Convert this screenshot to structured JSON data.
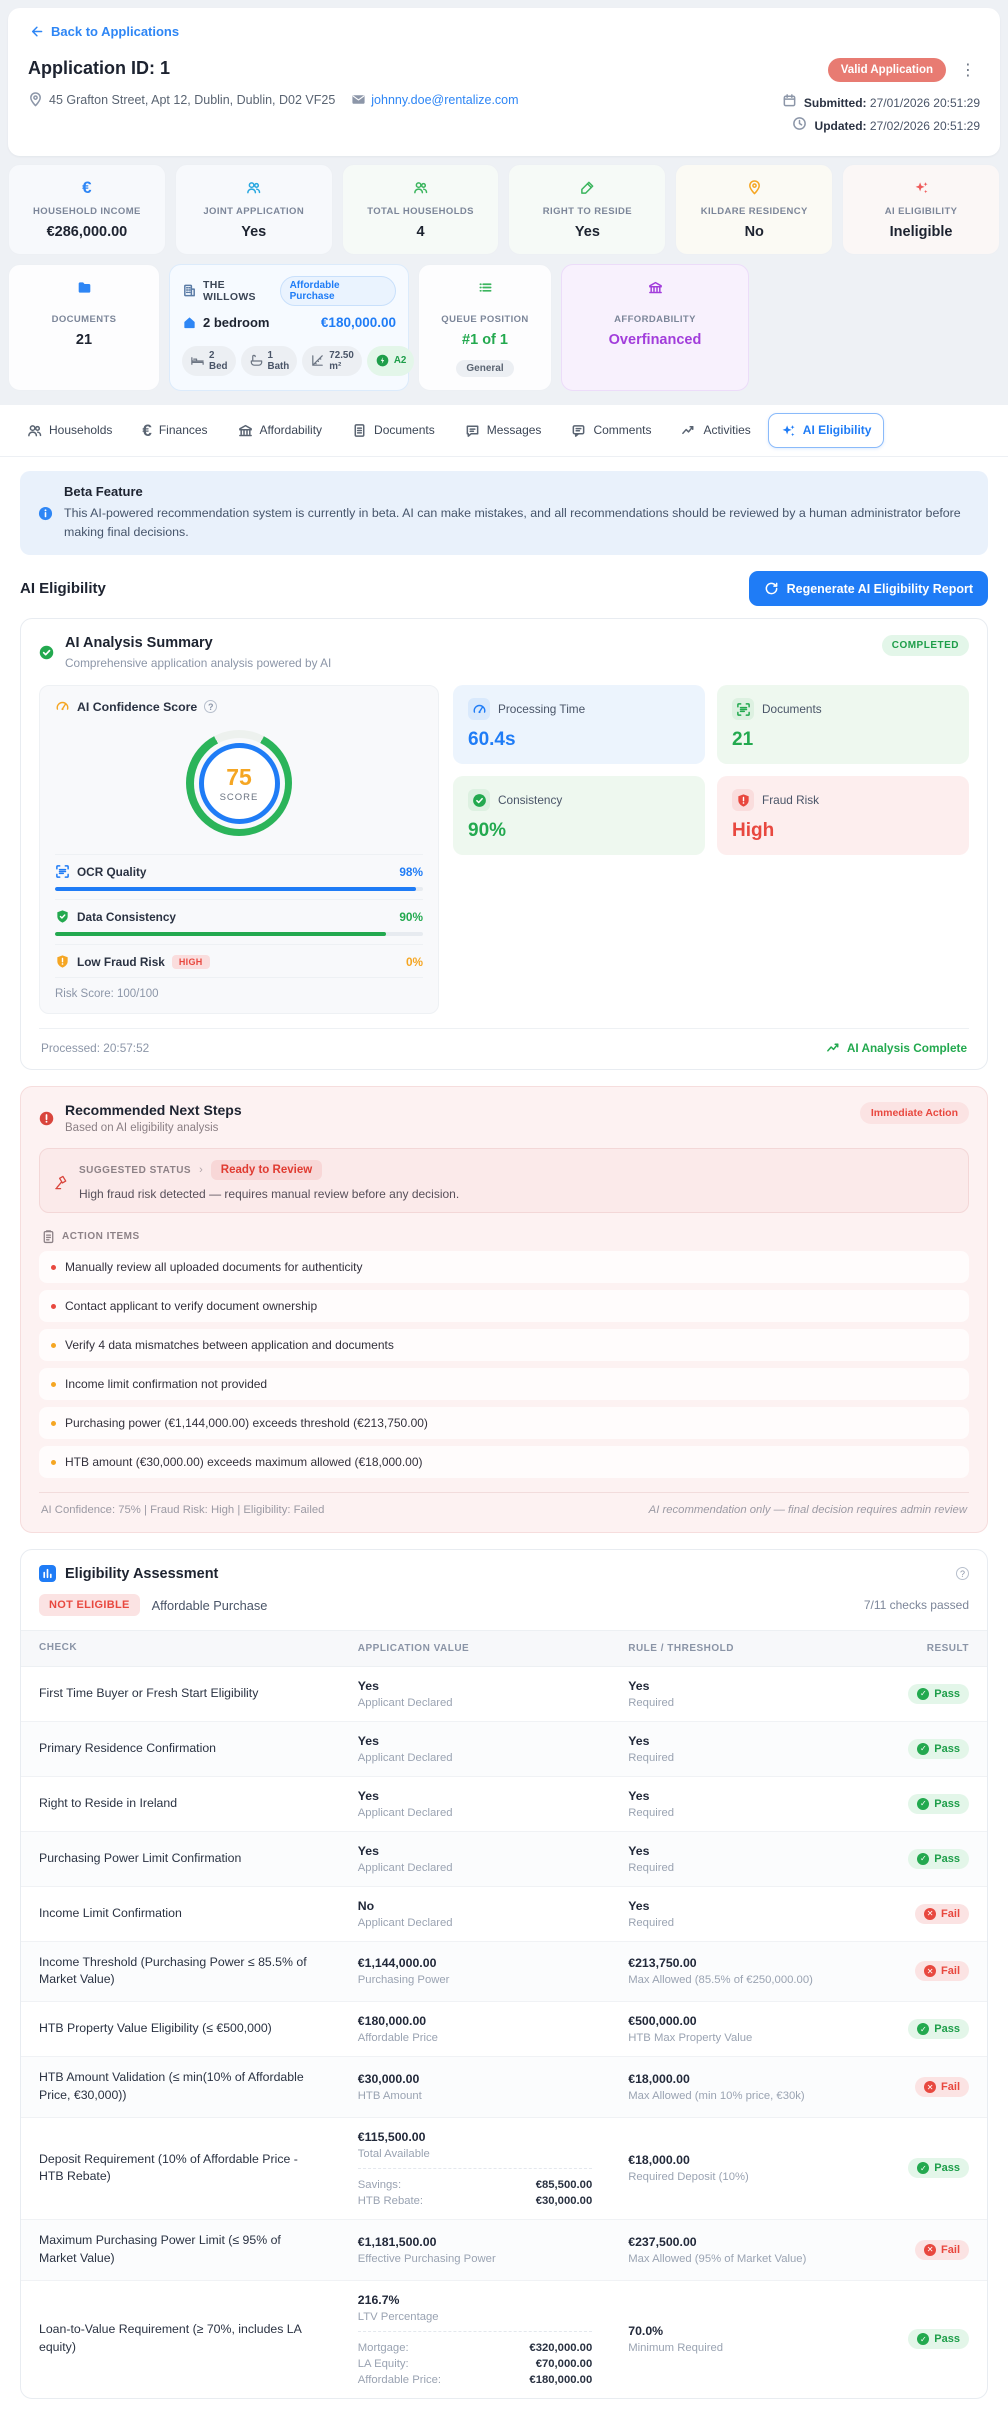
{
  "colors": {
    "accent_blue": "#1f7cf6",
    "green": "#23a94f",
    "red": "#e8483f",
    "orange": "#f5a623",
    "purple": "#a23ddb"
  },
  "header": {
    "back_label": "Back to Applications",
    "title": "Application ID: 1",
    "address": "45 Grafton Street, Apt 12, Dublin, Dublin, D02 VF25",
    "email": "johnny.doe@rentalize.com",
    "status_badge": "Valid Application",
    "submitted_label": "Submitted:",
    "submitted_value": "27/01/2026 20:51:29",
    "updated_label": "Updated:",
    "updated_value": "27/02/2026 20:51:29"
  },
  "stats": [
    {
      "label": "HOUSEHOLD INCOME",
      "value": "€286,000.00",
      "icon": "euro-icon",
      "accent": "#2e86f5"
    },
    {
      "label": "JOINT APPLICATION",
      "value": "Yes",
      "icon": "users-icon",
      "accent": "#29a8e0"
    },
    {
      "label": "TOTAL HOUSEHOLDS",
      "value": "4",
      "icon": "users-icon",
      "accent": "#3bb55e"
    },
    {
      "label": "RIGHT TO RESIDE",
      "value": "Yes",
      "icon": "signature-icon",
      "accent": "#3bb55e"
    },
    {
      "label": "KILDARE RESIDENCY",
      "value": "No",
      "icon": "location-pin-icon",
      "accent": "#f5a623"
    },
    {
      "label": "AI ELIGIBILITY",
      "value": "Ineligible",
      "icon": "sparkles-icon",
      "accent": "#ef5b5b"
    }
  ],
  "documents_card": {
    "label": "DOCUMENTS",
    "value": "21"
  },
  "property": {
    "name": "THE WILLOWS",
    "tag": "Affordable Purchase",
    "type": "2 bedroom",
    "price": "€180,000.00",
    "chips": [
      {
        "label": "2 Bed",
        "icon": "bed-icon"
      },
      {
        "label": "1 Bath",
        "icon": "bath-icon"
      },
      {
        "label": "72.50 m²",
        "icon": "ruler-icon"
      }
    ],
    "energy_rating": "A2"
  },
  "queue_card": {
    "label": "QUEUE POSITION",
    "value": "#1 of 1",
    "chip": "General"
  },
  "affordability_card": {
    "label": "AFFORDABILITY",
    "value": "Overfinanced"
  },
  "tabs": [
    {
      "label": "Households",
      "icon": "users-icon",
      "active": false
    },
    {
      "label": "Finances",
      "icon": "euro-icon",
      "active": false
    },
    {
      "label": "Affordability",
      "icon": "bank-icon",
      "active": false
    },
    {
      "label": "Documents",
      "icon": "document-icon",
      "active": false
    },
    {
      "label": "Messages",
      "icon": "message-icon",
      "active": false
    },
    {
      "label": "Comments",
      "icon": "comment-icon",
      "active": false
    },
    {
      "label": "Activities",
      "icon": "activity-icon",
      "active": false
    },
    {
      "label": "AI Eligibility",
      "icon": "sparkles-icon",
      "active": true
    }
  ],
  "beta": {
    "title": "Beta Feature",
    "text": "This AI-powered recommendation system is currently in beta. AI can make mistakes, and all recommendations should be reviewed by a human administrator before making final decisions."
  },
  "section": {
    "title": "AI Eligibility",
    "button": "Regenerate AI Eligibility Report"
  },
  "summary": {
    "title": "AI Analysis Summary",
    "subtitle": "Comprehensive application analysis powered by AI",
    "status": "COMPLETED",
    "confidence_label": "AI Confidence Score",
    "score": "75",
    "score_caption": "SCORE",
    "bars": [
      {
        "label": "OCR Quality",
        "icon": "scan-icon",
        "value": "98%",
        "pct": 98,
        "color": "#1f7cf6",
        "badge": "",
        "has_bar": true
      },
      {
        "label": "Data Consistency",
        "icon": "shield-check-icon",
        "value": "90%",
        "pct": 90,
        "color": "#23a94f",
        "badge": "",
        "has_bar": true
      },
      {
        "label": "Low Fraud Risk",
        "icon": "shield-alert-icon",
        "value": "0%",
        "pct": 0,
        "color": "#f5a623",
        "badge": "HIGH",
        "has_bar": false
      }
    ],
    "risk_score": "Risk Score: 100/100",
    "metrics": [
      {
        "label": "Processing Time",
        "value": "60.4s",
        "theme": "blue",
        "icon": "gauge-icon"
      },
      {
        "label": "Documents",
        "value": "21",
        "theme": "green",
        "icon": "scan-icon"
      },
      {
        "label": "Consistency",
        "value": "90%",
        "theme": "green",
        "icon": "check-circle-icon"
      },
      {
        "label": "Fraud Risk",
        "value": "High",
        "theme": "red",
        "icon": "shield-alert-icon"
      }
    ],
    "processed": "Processed: 20:57:52",
    "complete_label": "AI Analysis Complete"
  },
  "next_steps": {
    "title": "Recommended Next Steps",
    "subtitle": "Based on AI eligibility analysis",
    "badge": "Immediate Action",
    "suggested_label": "SUGGESTED STATUS",
    "suggested_caret": "›",
    "suggested_status": "Ready to Review",
    "suggested_note": "High fraud risk detected — requires manual review before any decision.",
    "action_items_label": "ACTION ITEMS",
    "items": [
      {
        "text": "Manually review all uploaded documents for authenticity",
        "level": "red"
      },
      {
        "text": "Contact applicant to verify document ownership",
        "level": "red"
      },
      {
        "text": "Verify 4 data mismatches between application and documents",
        "level": "orange"
      },
      {
        "text": "Income limit confirmation not provided",
        "level": "orange"
      },
      {
        "text": "Purchasing power (€1,144,000.00) exceeds threshold (€213,750.00)",
        "level": "orange"
      },
      {
        "text": "HTB amount (€30,000.00) exceeds maximum allowed (€18,000.00)",
        "level": "orange"
      }
    ],
    "footer_left": "AI Confidence: 75% | Fraud Risk: High | Eligibility: Failed",
    "footer_right": "AI recommendation only — final decision requires admin review"
  },
  "assessment": {
    "title": "Eligibility Assessment",
    "status_badge": "NOT ELIGIBLE",
    "scheme": "Affordable Purchase",
    "checks_passed": "7/11 checks passed",
    "columns": [
      "CHECK",
      "APPLICATION VALUE",
      "RULE / THRESHOLD",
      "RESULT"
    ],
    "rows": [
      {
        "check": "First Time Buyer or Fresh Start Eligibility",
        "app_value": "Yes",
        "app_sub": "Applicant Declared",
        "rule_value": "Yes",
        "rule_sub": "Required",
        "result": "Pass"
      },
      {
        "check": "Primary Residence Confirmation",
        "app_value": "Yes",
        "app_sub": "Applicant Declared",
        "rule_value": "Yes",
        "rule_sub": "Required",
        "result": "Pass"
      },
      {
        "check": "Right to Reside in Ireland",
        "app_value": "Yes",
        "app_sub": "Applicant Declared",
        "rule_value": "Yes",
        "rule_sub": "Required",
        "result": "Pass"
      },
      {
        "check": "Purchasing Power Limit Confirmation",
        "app_value": "Yes",
        "app_sub": "Applicant Declared",
        "rule_value": "Yes",
        "rule_sub": "Required",
        "result": "Pass"
      },
      {
        "check": "Income Limit Confirmation",
        "app_value": "No",
        "app_sub": "Applicant Declared",
        "rule_value": "Yes",
        "rule_sub": "Required",
        "result": "Fail"
      },
      {
        "check": "Income Threshold (Purchasing Power ≤ 85.5% of Market Value)",
        "app_value": "€1,144,000.00",
        "app_sub": "Purchasing Power",
        "rule_value": "€213,750.00",
        "rule_sub": "Max Allowed (85.5% of €250,000.00)",
        "result": "Fail"
      },
      {
        "check": "HTB Property Value Eligibility (≤ €500,000)",
        "app_value": "€180,000.00",
        "app_sub": "Affordable Price",
        "rule_value": "€500,000.00",
        "rule_sub": "HTB Max Property Value",
        "result": "Pass"
      },
      {
        "check": "HTB Amount Validation (≤ min(10% of Affordable Price, €30,000))",
        "app_value": "€30,000.00",
        "app_sub": "HTB Amount",
        "rule_value": "€18,000.00",
        "rule_sub": "Max Allowed (min 10% price, €30k)",
        "result": "Fail"
      },
      {
        "check": "Deposit Requirement (10% of Affordable Price - HTB Rebate)",
        "app_value": "€115,500.00",
        "app_sub": "Total Available",
        "breakdown": [
          {
            "label": "Savings:",
            "value": "€85,500.00"
          },
          {
            "label": "HTB Rebate:",
            "value": "€30,000.00"
          }
        ],
        "rule_value": "€18,000.00",
        "rule_sub": "Required Deposit (10%)",
        "result": "Pass"
      },
      {
        "check": "Maximum Purchasing Power Limit (≤ 95% of Market Value)",
        "app_value": "€1,181,500.00",
        "app_sub": "Effective Purchasing Power",
        "rule_value": "€237,500.00",
        "rule_sub": "Max Allowed (95% of Market Value)",
        "result": "Fail"
      },
      {
        "check": "Loan-to-Value Requirement (≥ 70%, includes LA equity)",
        "app_value": "216.7%",
        "app_sub": "LTV Percentage",
        "breakdown": [
          {
            "label": "Mortgage:",
            "value": "€320,000.00"
          },
          {
            "label": "LA Equity:",
            "value": "€70,000.00"
          },
          {
            "label": "Affordable Price:",
            "value": "€180,000.00"
          }
        ],
        "rule_value": "70.0%",
        "rule_sub": "Minimum Required",
        "result": "Pass"
      }
    ]
  }
}
